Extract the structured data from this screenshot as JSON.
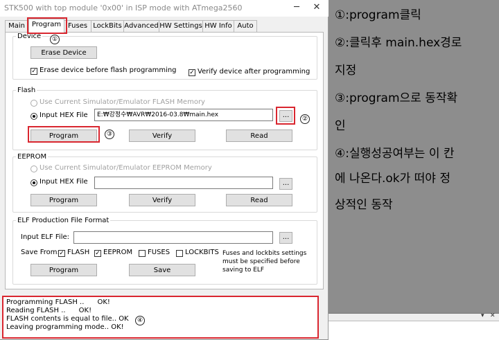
{
  "window": {
    "title": "STK500 with top module '0x00' in ISP mode with ATmega2560",
    "minimize": "─",
    "close": "✕"
  },
  "tabs": [
    "Main",
    "Program",
    "Fuses",
    "LockBits",
    "Advanced",
    "HW Settings",
    "HW Info",
    "Auto"
  ],
  "active_tab": "Program",
  "device": {
    "legend": "Device",
    "erase_button": "Erase Device",
    "erase_before_label": "Erase device before flash programming",
    "erase_before_checked": true,
    "verify_after_label": "Verify device after programming",
    "verify_after_checked": true
  },
  "flash": {
    "legend": "Flash",
    "simulator_label": "Use Current Simulator/Emulator FLASH Memory",
    "input_hex_label": "Input HEX File",
    "hex_path": "E:₩강정수₩AVR₩2016-03.8₩main.hex",
    "browse": "...",
    "program": "Program",
    "verify": "Verify",
    "read": "Read"
  },
  "eeprom": {
    "legend": "EEPROM",
    "simulator_label": "Use Current Simulator/Emulator EEPROM Memory",
    "input_hex_label": "Input HEX File",
    "hex_path": "",
    "browse": "...",
    "program": "Program",
    "verify": "Verify",
    "read": "Read"
  },
  "elf": {
    "legend": "ELF Production File Format",
    "input_label": "Input ELF File:",
    "input_value": "",
    "browse": "...",
    "save_from_label": "Save From:",
    "options": [
      {
        "label": "FLASH",
        "checked": true
      },
      {
        "label": "EEPROM",
        "checked": true
      },
      {
        "label": "FUSES",
        "checked": false
      },
      {
        "label": "LOCKBITS",
        "checked": false
      }
    ],
    "note_lines": [
      "Fuses and lockbits settings",
      "must be specified before",
      "saving to ELF"
    ],
    "program": "Program",
    "save": "Save"
  },
  "log": [
    "Programming FLASH ..      OK!",
    "Reading FLASH ..      OK!",
    "FLASH contents is equal to file.. OK",
    "Leaving programming mode.. OK!"
  ],
  "callouts": [
    "①",
    "②",
    "③",
    "④"
  ],
  "notes": [
    "①:program클릭",
    "②:클릭후 main.hex경로",
    "지정",
    "③:program으로 동작확",
    "인",
    "④:실행성공여부는 이 칸",
    "에 나온다.ok가 떠야 정",
    "상적인 동작"
  ],
  "second_pane": {
    "dropdown": "▾",
    "close": "✕"
  },
  "colors": {
    "annotation_red": "#d9262f",
    "dialog_bg": "#f0f0f0",
    "side_bg": "#8d8d8d"
  }
}
